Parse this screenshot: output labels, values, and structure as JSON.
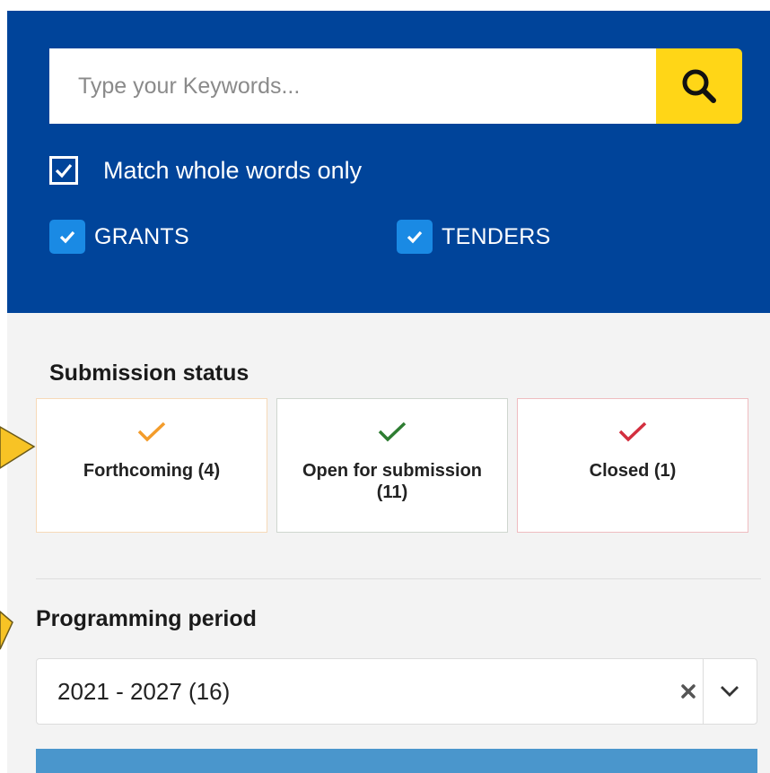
{
  "search": {
    "placeholder": "Type your Keywords...",
    "button_icon": "search-icon",
    "match_whole_words_label": "Match whole words only",
    "match_whole_words_checked": true
  },
  "types": [
    {
      "label": "GRANTS",
      "checked": true
    },
    {
      "label": "TENDERS",
      "checked": true
    }
  ],
  "submission_status": {
    "heading": "Submission status",
    "options": [
      {
        "label": "Forthcoming (4)",
        "check_color": "#f39c2b"
      },
      {
        "label": "Open for submission (11)",
        "check_color": "#2e7d32"
      },
      {
        "label": "Closed (1)",
        "check_color": "#d32f3f"
      }
    ]
  },
  "programming_period": {
    "heading": "Programming period",
    "selected_value": "2021 - 2027 (16)",
    "clear_icon": "clear-icon",
    "dropdown_icon": "chevron-down-icon"
  },
  "colors": {
    "search_panel": "#00449a",
    "search_button": "#ffd617",
    "checkbox": "#1a8ae4",
    "bottom_button": "#4a96cc",
    "callout": "#f7c325"
  }
}
